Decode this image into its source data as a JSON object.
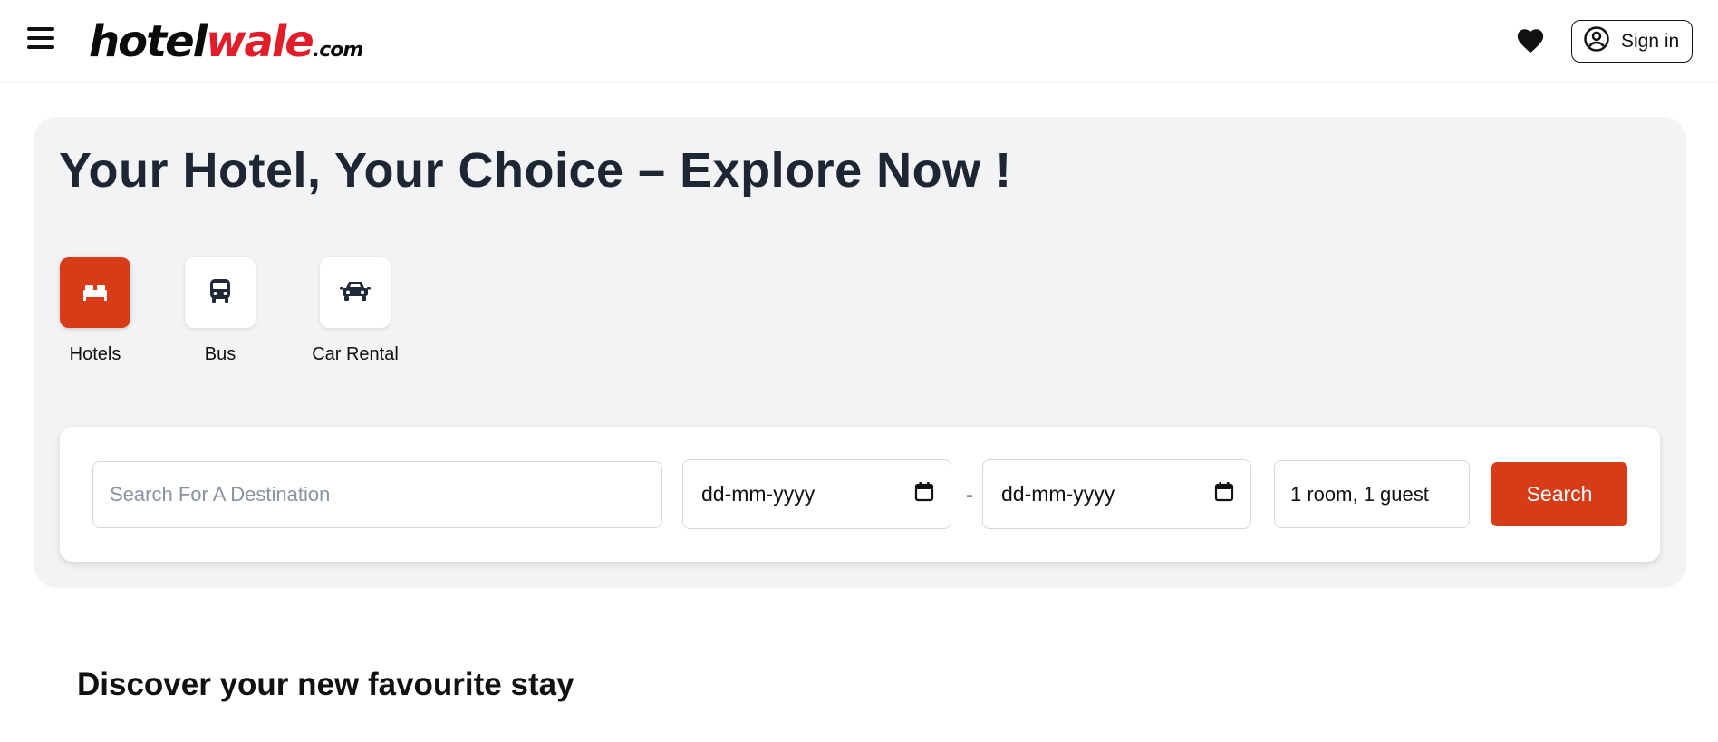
{
  "header": {
    "logo": {
      "part1": "hotel",
      "part2": "wale",
      "part3": ".com"
    },
    "menu_icon": "hamburger-menu-icon",
    "wishlist_icon": "heart-icon",
    "signin": {
      "label": "Sign in",
      "icon": "user-circle-icon"
    }
  },
  "hero": {
    "title": "Your Hotel, Your Choice – Explore Now !",
    "categories": [
      {
        "label": "Hotels",
        "icon": "bed-icon",
        "active": true
      },
      {
        "label": "Bus",
        "icon": "bus-icon",
        "active": false
      },
      {
        "label": "Car Rental",
        "icon": "car-icon",
        "active": false
      }
    ]
  },
  "search": {
    "destination_placeholder": "Search For A Destination",
    "checkin": "dd-mm-yyyy",
    "separator": "-",
    "checkout": "dd-mm-yyyy",
    "calendar_icon": "calendar-icon",
    "guests": "1 room, 1 guest",
    "button_label": "Search"
  },
  "section": {
    "discover_title": "Discover your new favourite stay"
  },
  "colors": {
    "accent": "#d63c17",
    "logo_red": "#e11d2a",
    "hero_bg": "#f2f3f5",
    "title": "#1e2533"
  }
}
